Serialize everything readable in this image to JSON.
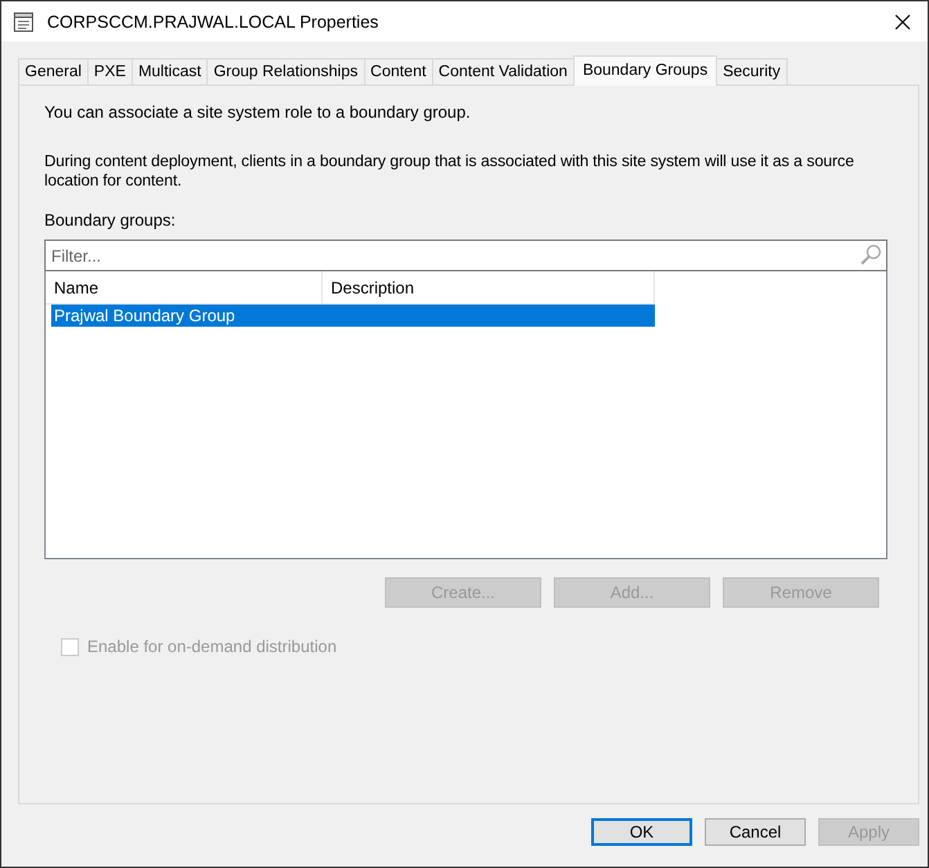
{
  "window": {
    "title": "CORPSCCM.PRAJWAL.LOCAL Properties"
  },
  "tabs": [
    {
      "label": "General",
      "selected": false
    },
    {
      "label": "PXE",
      "selected": false
    },
    {
      "label": "Multicast",
      "selected": false
    },
    {
      "label": "Group Relationships",
      "selected": false
    },
    {
      "label": "Content",
      "selected": false
    },
    {
      "label": "Content Validation",
      "selected": false
    },
    {
      "label": "Boundary Groups",
      "selected": true
    },
    {
      "label": "Security",
      "selected": false
    }
  ],
  "intro": "You can associate a site system role to a boundary group.",
  "description": "During content deployment, clients in a boundary group that is associated with this site system will use it as a source location for content.",
  "list_label": "Boundary groups:",
  "filter": {
    "placeholder": "Filter..."
  },
  "table": {
    "columns": [
      "Name",
      "Description"
    ],
    "rows": [
      {
        "cells": [
          "Prajwal Boundary Group",
          ""
        ],
        "selected": true
      }
    ]
  },
  "list_buttons": [
    {
      "label": "Create...",
      "disabled": true
    },
    {
      "label": "Add...",
      "disabled": true
    },
    {
      "label": "Remove",
      "disabled": true
    }
  ],
  "on_demand": {
    "label": "Enable for on-demand distribution",
    "checked": false,
    "disabled": true
  },
  "dialog_buttons": [
    {
      "label": "OK",
      "default": true,
      "disabled": false
    },
    {
      "label": "Cancel",
      "default": false,
      "disabled": false
    },
    {
      "label": "Apply",
      "default": false,
      "disabled": true
    }
  ]
}
